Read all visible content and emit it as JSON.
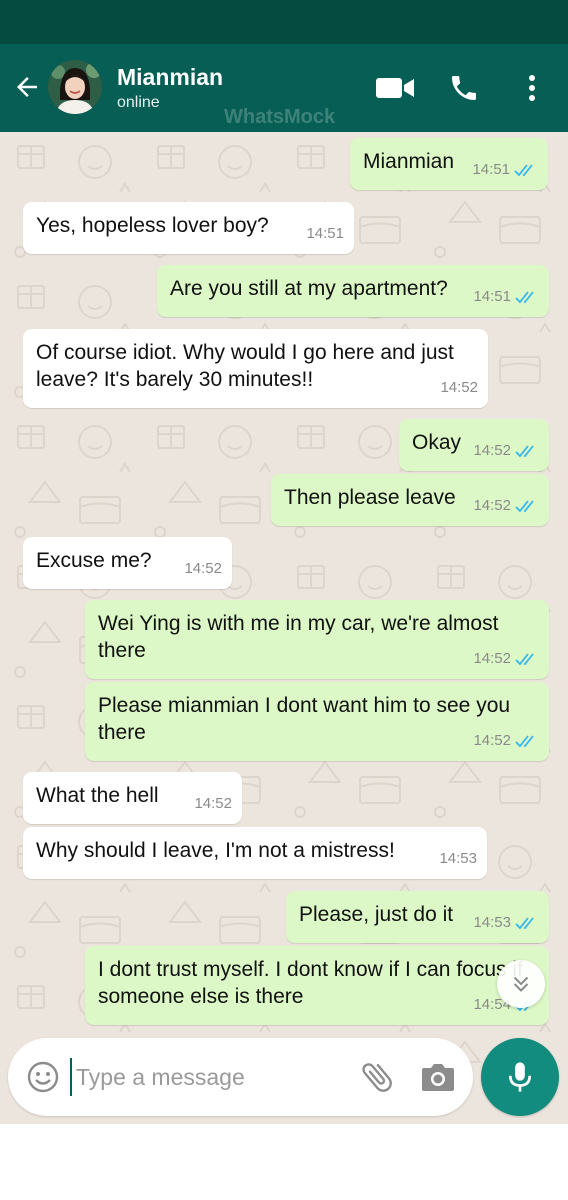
{
  "header": {
    "contact_name": "Mianmian",
    "status": "online",
    "watermark": "WhatsMock"
  },
  "icons": {
    "back": "arrow-left-icon",
    "video": "video-camera-icon",
    "call": "phone-icon",
    "menu": "more-vertical-icon",
    "emoji": "emoji-icon",
    "attach": "paperclip-icon",
    "camera": "camera-icon",
    "mic": "microphone-icon",
    "scroll": "chevron-double-down-icon"
  },
  "colors": {
    "header": "#075e54",
    "status_bar": "#054b40",
    "chat_bg": "#ece5dd",
    "outgoing_bubble": "#dcf8c6",
    "incoming_bubble": "#ffffff",
    "read_ticks": "#34b7f1",
    "mic_button": "#128c7e"
  },
  "messages": [
    {
      "direction": "out",
      "text": "Mianmian",
      "time": "14:51",
      "read": true
    },
    {
      "direction": "in",
      "text": "Yes, hopeless lover boy?",
      "time": "14:51"
    },
    {
      "direction": "out",
      "text": "Are you still at my apartment?",
      "time": "14:51",
      "read": true
    },
    {
      "direction": "in",
      "text": "Of course idiot. Why would I go here and just leave? It's barely 30 minutes!!",
      "time": "14:52"
    },
    {
      "direction": "out",
      "text": "Okay",
      "time": "14:52",
      "read": true
    },
    {
      "direction": "out",
      "text": "Then please leave",
      "time": "14:52",
      "read": true
    },
    {
      "direction": "in",
      "text": "Excuse me?",
      "time": "14:52"
    },
    {
      "direction": "out",
      "text": "Wei Ying is with me in my car, we're almost there",
      "time": "14:52",
      "read": true
    },
    {
      "direction": "out",
      "text": "Please mianmian I dont want him to see you there",
      "time": "14:52",
      "read": true
    },
    {
      "direction": "in",
      "text": "What the hell",
      "time": "14:52"
    },
    {
      "direction": "in",
      "text": "Why should I leave, I'm not a mistress!",
      "time": "14:53"
    },
    {
      "direction": "out",
      "text": "Please, just do it",
      "time": "14:53",
      "read": true
    },
    {
      "direction": "out",
      "text": "I dont trust myself. I dont know if I can focus if someone else is there",
      "time": "14:54",
      "read": true
    }
  ],
  "composer": {
    "placeholder": "Type a message",
    "value": ""
  }
}
